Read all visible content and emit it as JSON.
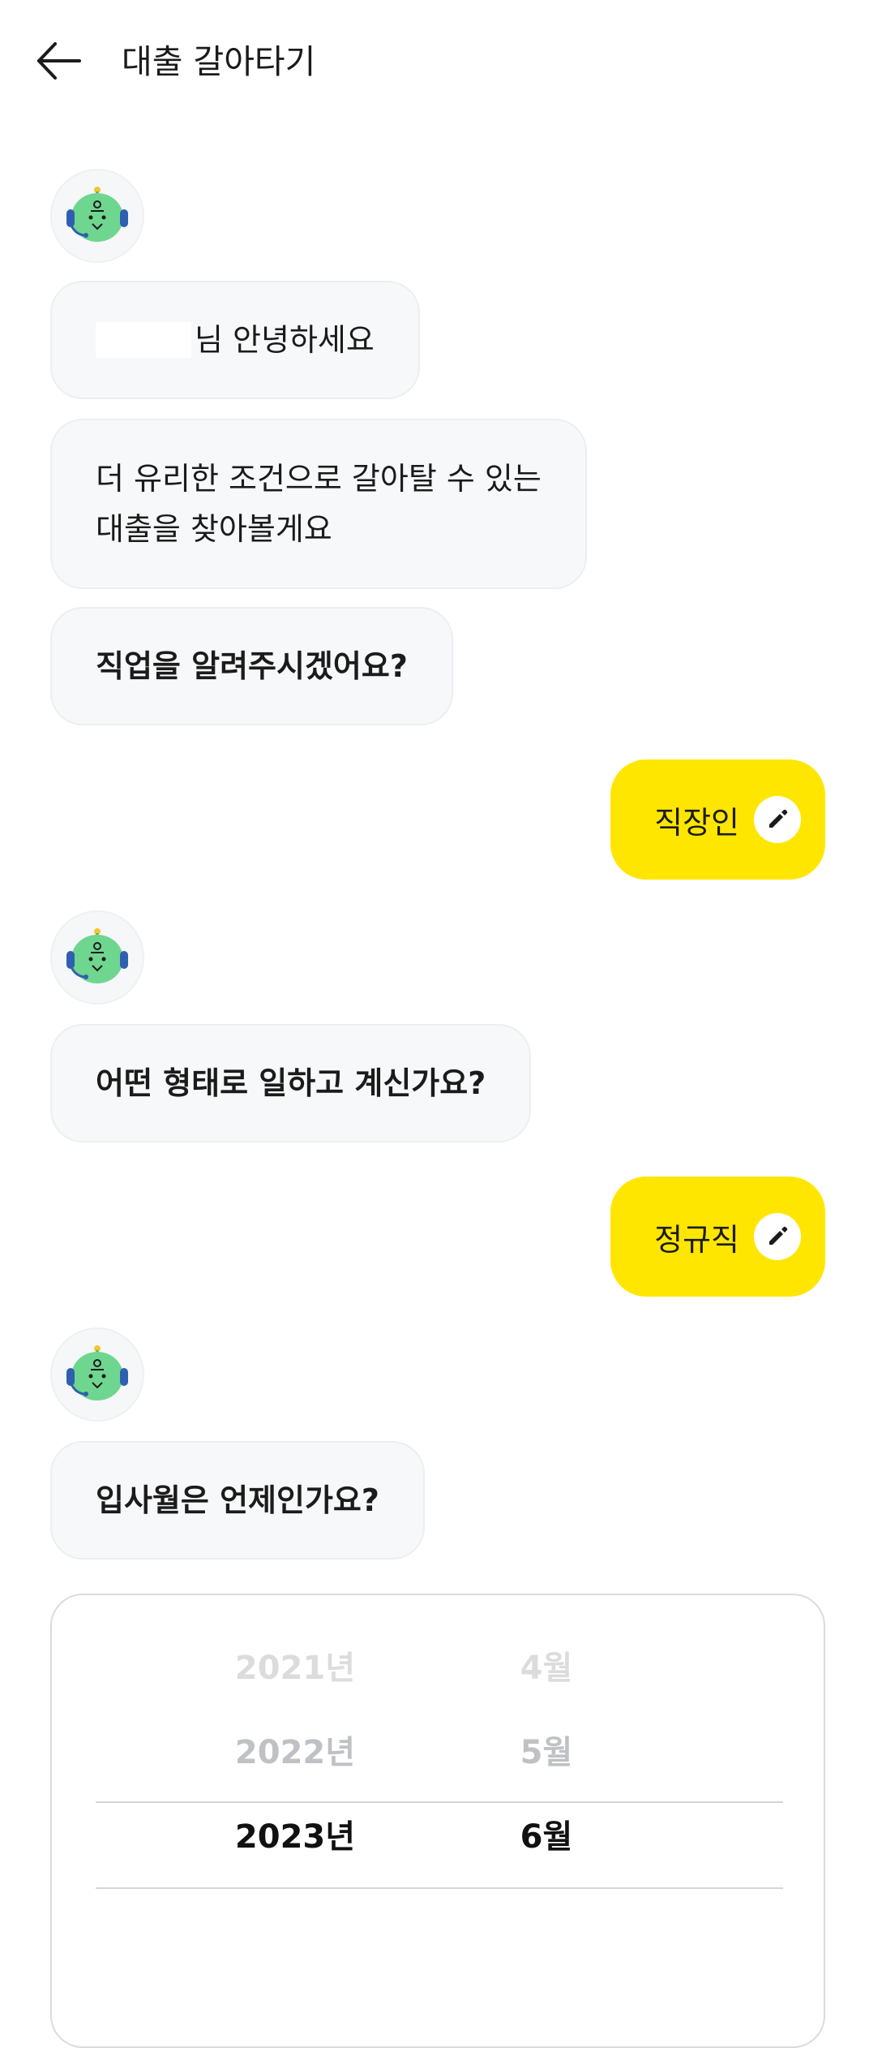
{
  "header": {
    "title": "대출 갈아타기",
    "back_icon": "arrow-left-icon"
  },
  "messages": [
    {
      "type": "bot",
      "text": "님 안녕하세요",
      "redacted_name": true
    },
    {
      "type": "bot",
      "text_lines": [
        "더 유리한 조건으로 갈아탈 수 있는",
        "대출을 찾아볼게요"
      ]
    },
    {
      "type": "bot",
      "text": "직업을 알려주시겠어요?",
      "bold": true
    },
    {
      "type": "user",
      "text": "직장인",
      "icon": "pencil-icon"
    },
    {
      "type": "bot",
      "text": "어떤 형태로 일하고 계신가요?",
      "bold": true
    },
    {
      "type": "user",
      "text": "정규직",
      "icon": "pencil-icon"
    },
    {
      "type": "bot",
      "text": "입사월은 언제인가요?",
      "bold": true
    }
  ],
  "picker": {
    "years": [
      "2021년",
      "2022년",
      "2023년"
    ],
    "months": [
      "4월",
      "5월",
      "6월"
    ],
    "selected_year": "2023년",
    "selected_month": "6월"
  },
  "colors": {
    "accent": "#ffe600",
    "bubble_bg": "#f7f8fa",
    "avatar_green": "#6fd68f",
    "headset_blue": "#2f5fb0"
  }
}
